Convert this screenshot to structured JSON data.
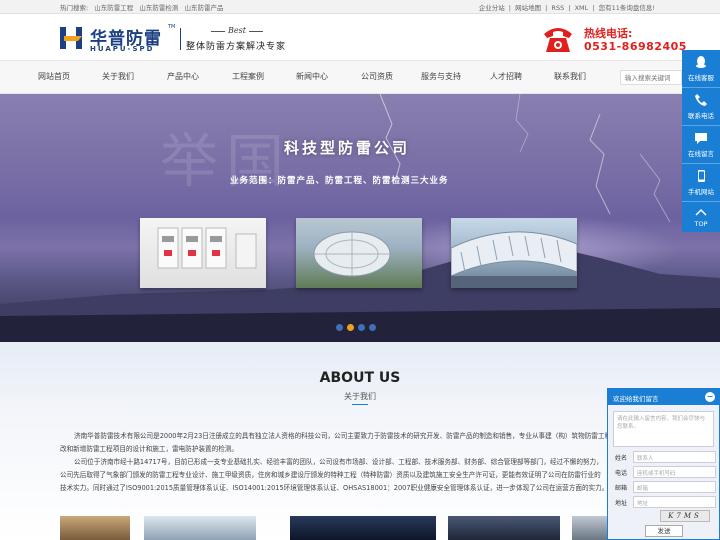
{
  "topbar": {
    "hot_label": "热门搜索:",
    "hot_items": [
      "山东防雷工程",
      "山东防雷检测",
      "山东防雷产品"
    ],
    "right_links": [
      "企业分站",
      "|",
      "网站地图",
      "|",
      "RSS",
      "|",
      "XML",
      "|",
      "您有11条询盘信息!"
    ]
  },
  "header": {
    "logo_cn": "华普防雷",
    "logo_en": "HUAPU-SPD",
    "logo_tm": "TM",
    "slogan_best": "Best",
    "slogan": "整体防雷方案解决专家",
    "hotline_label": "热线电话:",
    "hotline_number": "0531-86982405"
  },
  "nav": {
    "items": [
      "网站首页",
      "关于我们",
      "产品中心",
      "工程案例",
      "新闻中心",
      "公司资质",
      "服务与支持",
      "人才招聘",
      "联系我们"
    ],
    "search_placeholder": "输入搜索关键词"
  },
  "banner": {
    "title": "科技型防雷公司",
    "subtitle": "业务范围：防雷产品、防雷工程、防雷检测三大业务",
    "ghost_text": "举国",
    "dots": 4,
    "active_dot": 1
  },
  "float_bar": {
    "items": [
      {
        "label": "在线客服",
        "icon": "qq-icon"
      },
      {
        "label": "联系电话",
        "icon": "phone-icon"
      },
      {
        "label": "在线留言",
        "icon": "message-icon"
      },
      {
        "label": "手机网站",
        "icon": "mobile-icon"
      },
      {
        "label": "TOP",
        "icon": "arrow-up-icon"
      }
    ]
  },
  "about": {
    "title": "ABOUT US",
    "subtitle": "关于我们",
    "paragraphs": [
      "济南华普防雷技术有限公司是2000年2月23日注册成立的具有独立法人资格的科技公司，公司主要致力于防雷技术的研究开发、防雷产品的制造和销售，专业从事建（构）筑物防雷工程设计施工、防雷",
      "改和新增防雷工程项目的设计和施工，雷电防护装置的检测。",
      "公司位于济南市经十路14717号，目前已形成一支专业基础扎实、经验丰富的团队，公司设有市场部、设计部、工程部、技术服务部、财务部、综合管理部等部门，经过不懈的努力，",
      "公司先后取得了气象部门颁发的防雷工程专业设计、施工甲级资质，住房和城乡建设厅颁发的特种工程（特种防雷）资质以及建筑施工安全生产许可证，更能有效证明了公司在防雷行业的",
      "技术实力。同时通过了ISO9001:2015质量管理体系认证、ISO14001:2015环境管理体系认证、OHSAS18001：2007职业健康安全管理体系认证，进一步体现了公司在运营方面的实力。"
    ]
  },
  "message_box": {
    "title": "欢迎给我们留言",
    "content_placeholder": "请在此输入留言内容，我们会尽快与您联系。",
    "fields": [
      {
        "label": "姓名",
        "placeholder": "联系人"
      },
      {
        "label": "电话",
        "placeholder": "座机或手机号码"
      },
      {
        "label": "邮箱",
        "placeholder": "邮箱"
      },
      {
        "label": "地址",
        "placeholder": "地址"
      }
    ],
    "captcha": "K7MS",
    "submit": "发送"
  },
  "colors": {
    "brand_blue": "#1a7fd4",
    "logo_blue": "#1a3f82",
    "hotline_red": "#e0201d",
    "dot_active": "#f0a21e"
  }
}
